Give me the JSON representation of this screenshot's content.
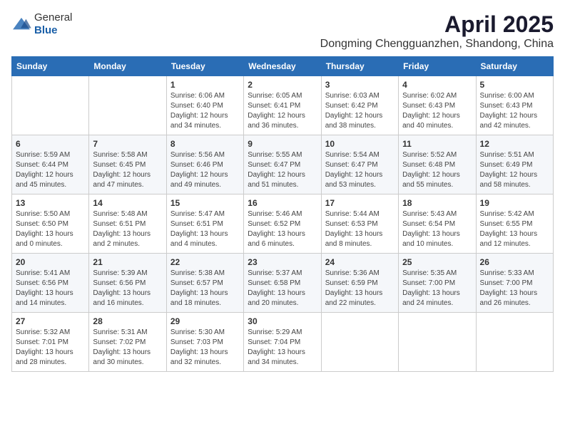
{
  "header": {
    "logo_general": "General",
    "logo_blue": "Blue",
    "month_title": "April 2025",
    "location": "Dongming Chengguanzhen, Shandong, China"
  },
  "weekdays": [
    "Sunday",
    "Monday",
    "Tuesday",
    "Wednesday",
    "Thursday",
    "Friday",
    "Saturday"
  ],
  "weeks": [
    [
      {
        "day": "",
        "info": ""
      },
      {
        "day": "",
        "info": ""
      },
      {
        "day": "1",
        "info": "Sunrise: 6:06 AM\nSunset: 6:40 PM\nDaylight: 12 hours and 34 minutes."
      },
      {
        "day": "2",
        "info": "Sunrise: 6:05 AM\nSunset: 6:41 PM\nDaylight: 12 hours and 36 minutes."
      },
      {
        "day": "3",
        "info": "Sunrise: 6:03 AM\nSunset: 6:42 PM\nDaylight: 12 hours and 38 minutes."
      },
      {
        "day": "4",
        "info": "Sunrise: 6:02 AM\nSunset: 6:43 PM\nDaylight: 12 hours and 40 minutes."
      },
      {
        "day": "5",
        "info": "Sunrise: 6:00 AM\nSunset: 6:43 PM\nDaylight: 12 hours and 42 minutes."
      }
    ],
    [
      {
        "day": "6",
        "info": "Sunrise: 5:59 AM\nSunset: 6:44 PM\nDaylight: 12 hours and 45 minutes."
      },
      {
        "day": "7",
        "info": "Sunrise: 5:58 AM\nSunset: 6:45 PM\nDaylight: 12 hours and 47 minutes."
      },
      {
        "day": "8",
        "info": "Sunrise: 5:56 AM\nSunset: 6:46 PM\nDaylight: 12 hours and 49 minutes."
      },
      {
        "day": "9",
        "info": "Sunrise: 5:55 AM\nSunset: 6:47 PM\nDaylight: 12 hours and 51 minutes."
      },
      {
        "day": "10",
        "info": "Sunrise: 5:54 AM\nSunset: 6:47 PM\nDaylight: 12 hours and 53 minutes."
      },
      {
        "day": "11",
        "info": "Sunrise: 5:52 AM\nSunset: 6:48 PM\nDaylight: 12 hours and 55 minutes."
      },
      {
        "day": "12",
        "info": "Sunrise: 5:51 AM\nSunset: 6:49 PM\nDaylight: 12 hours and 58 minutes."
      }
    ],
    [
      {
        "day": "13",
        "info": "Sunrise: 5:50 AM\nSunset: 6:50 PM\nDaylight: 13 hours and 0 minutes."
      },
      {
        "day": "14",
        "info": "Sunrise: 5:48 AM\nSunset: 6:51 PM\nDaylight: 13 hours and 2 minutes."
      },
      {
        "day": "15",
        "info": "Sunrise: 5:47 AM\nSunset: 6:51 PM\nDaylight: 13 hours and 4 minutes."
      },
      {
        "day": "16",
        "info": "Sunrise: 5:46 AM\nSunset: 6:52 PM\nDaylight: 13 hours and 6 minutes."
      },
      {
        "day": "17",
        "info": "Sunrise: 5:44 AM\nSunset: 6:53 PM\nDaylight: 13 hours and 8 minutes."
      },
      {
        "day": "18",
        "info": "Sunrise: 5:43 AM\nSunset: 6:54 PM\nDaylight: 13 hours and 10 minutes."
      },
      {
        "day": "19",
        "info": "Sunrise: 5:42 AM\nSunset: 6:55 PM\nDaylight: 13 hours and 12 minutes."
      }
    ],
    [
      {
        "day": "20",
        "info": "Sunrise: 5:41 AM\nSunset: 6:56 PM\nDaylight: 13 hours and 14 minutes."
      },
      {
        "day": "21",
        "info": "Sunrise: 5:39 AM\nSunset: 6:56 PM\nDaylight: 13 hours and 16 minutes."
      },
      {
        "day": "22",
        "info": "Sunrise: 5:38 AM\nSunset: 6:57 PM\nDaylight: 13 hours and 18 minutes."
      },
      {
        "day": "23",
        "info": "Sunrise: 5:37 AM\nSunset: 6:58 PM\nDaylight: 13 hours and 20 minutes."
      },
      {
        "day": "24",
        "info": "Sunrise: 5:36 AM\nSunset: 6:59 PM\nDaylight: 13 hours and 22 minutes."
      },
      {
        "day": "25",
        "info": "Sunrise: 5:35 AM\nSunset: 7:00 PM\nDaylight: 13 hours and 24 minutes."
      },
      {
        "day": "26",
        "info": "Sunrise: 5:33 AM\nSunset: 7:00 PM\nDaylight: 13 hours and 26 minutes."
      }
    ],
    [
      {
        "day": "27",
        "info": "Sunrise: 5:32 AM\nSunset: 7:01 PM\nDaylight: 13 hours and 28 minutes."
      },
      {
        "day": "28",
        "info": "Sunrise: 5:31 AM\nSunset: 7:02 PM\nDaylight: 13 hours and 30 minutes."
      },
      {
        "day": "29",
        "info": "Sunrise: 5:30 AM\nSunset: 7:03 PM\nDaylight: 13 hours and 32 minutes."
      },
      {
        "day": "30",
        "info": "Sunrise: 5:29 AM\nSunset: 7:04 PM\nDaylight: 13 hours and 34 minutes."
      },
      {
        "day": "",
        "info": ""
      },
      {
        "day": "",
        "info": ""
      },
      {
        "day": "",
        "info": ""
      }
    ]
  ]
}
